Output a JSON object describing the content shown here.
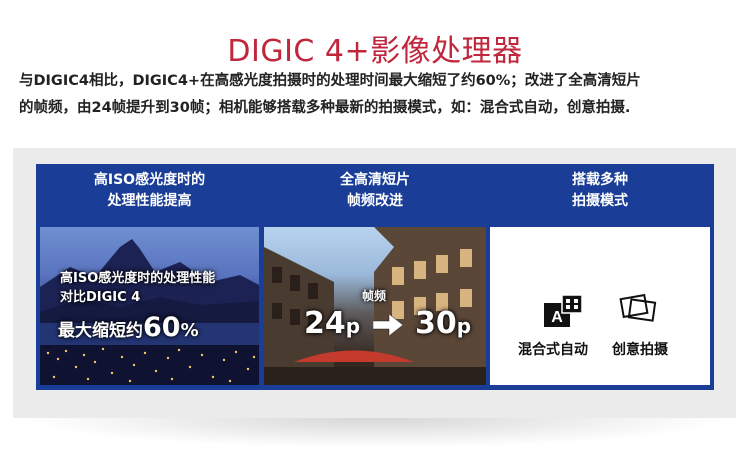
{
  "title": "DIGIC 4+影像处理器",
  "description": {
    "line1": "与DIGIC4相比，DIGIC4+在高感光度拍摄时的处理时间最大缩短了约60%；改进了全高清短片",
    "line2": "的帧频，由24帧提升到30帧；相机能够搭载多种最新的拍摄模式，如：混合式自动，创意拍摄."
  },
  "columns": [
    {
      "heading_line1": "高ISO感光度时的",
      "heading_line2": "处理性能提高",
      "overlay_line1": "高ISO感光度时的处理性能",
      "overlay_line2": "对比DIGIC 4",
      "overlay_big_prefix": "最大缩短约",
      "overlay_big_value": "60",
      "overlay_big_unit": "%"
    },
    {
      "heading_line1": "全高清短片",
      "heading_line2": "帧频改进",
      "overlay_small": "帧频",
      "from_value": "24",
      "from_unit": "p",
      "to_value": "30",
      "to_unit": "p"
    },
    {
      "heading_line1": "搭载多种",
      "heading_line2": "拍摄模式",
      "mode1_label": "混合式自动",
      "mode2_label": "创意拍摄",
      "mode1_badge": "A"
    }
  ],
  "colors": {
    "title": "#c0263c",
    "frame_blue": "#1a3e97",
    "panel_gray": "#ebebeb"
  }
}
